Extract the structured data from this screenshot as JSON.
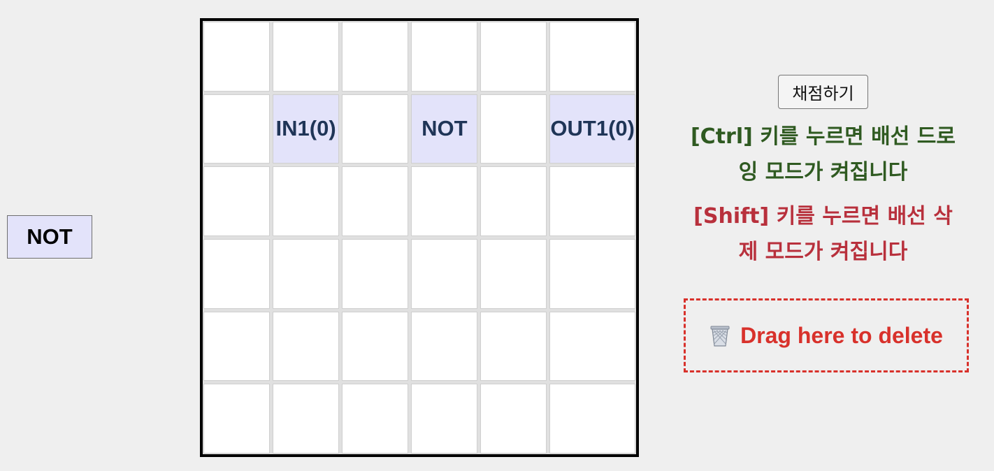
{
  "palette": {
    "gates": [
      {
        "label": "NOT"
      }
    ]
  },
  "board": {
    "rows": 6,
    "cols": 6,
    "placed": [
      {
        "row": 1,
        "col": 1,
        "label": "IN1(0)",
        "name": "input-gate-in1"
      },
      {
        "row": 1,
        "col": 3,
        "label": "NOT",
        "name": "not-gate"
      },
      {
        "row": 1,
        "col": 5,
        "label": "OUT1(0)",
        "name": "output-gate-out1"
      }
    ]
  },
  "controls": {
    "grade_label": "채점하기"
  },
  "hints": {
    "ctrl_line1": "[Ctrl] 키를 누르면 배선 드로",
    "ctrl_line2": "잉 모드가 켜집니다",
    "shift_line1": "[Shift] 키를 누르면 배선 삭",
    "shift_line2": "제 모드가 켜집니다"
  },
  "trash": {
    "icon": "trash-bin-icon",
    "label": "Drag here to delete"
  },
  "colors": {
    "gate_fill": "#e3e3fa",
    "gate_text": "#1f3557",
    "ctrl_hint": "#2f5a21",
    "shift_hint": "#b8303c",
    "trash_accent": "#d8312b"
  }
}
